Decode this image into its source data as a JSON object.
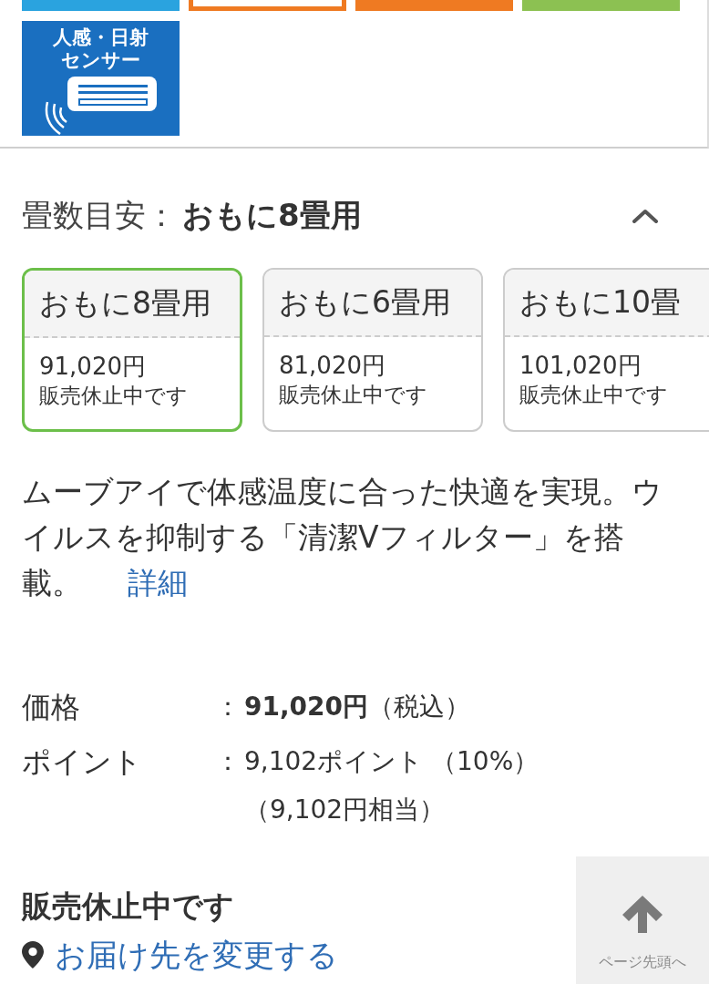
{
  "feature_tiles": [
    {
      "kind": "filled",
      "color": "#2aa3df"
    },
    {
      "kind": "outlined",
      "color": "#ef7a22"
    },
    {
      "kind": "filled",
      "color": "#ef7a22"
    },
    {
      "kind": "filled",
      "color": "#8cc152"
    }
  ],
  "sensor_badge": {
    "lines": [
      "人感・日射",
      "センサー"
    ]
  },
  "size_selector": {
    "label": "畳数目安：",
    "value": "おもに8畳用",
    "expanded": true,
    "options": [
      {
        "label": "おもに8畳用",
        "price": "91,020円",
        "status": "販売休止中です",
        "selected": true
      },
      {
        "label": "おもに6畳用",
        "price": "81,020円",
        "status": "販売休止中です",
        "selected": false
      },
      {
        "label": "おもに10畳",
        "price": "101,020円",
        "status": "販売休止中です",
        "selected": false
      }
    ]
  },
  "description": {
    "text": "ムーブアイで体感温度に合った快適を実現。ウイルスを抑制する「清潔Vフィルター」を搭載。",
    "link": "詳細"
  },
  "price_table": [
    {
      "label": "価格",
      "separator": "：",
      "value": "**91,020円**（税込）"
    },
    {
      "label": "ポイント",
      "separator": "：",
      "value": "9,102ポイント （10%）",
      "note": "（9,102円相当）"
    }
  ],
  "availability": "販売休止中です",
  "delivery_link": "お届け先を変更する",
  "back_to_top": "ページ先頭へ"
}
